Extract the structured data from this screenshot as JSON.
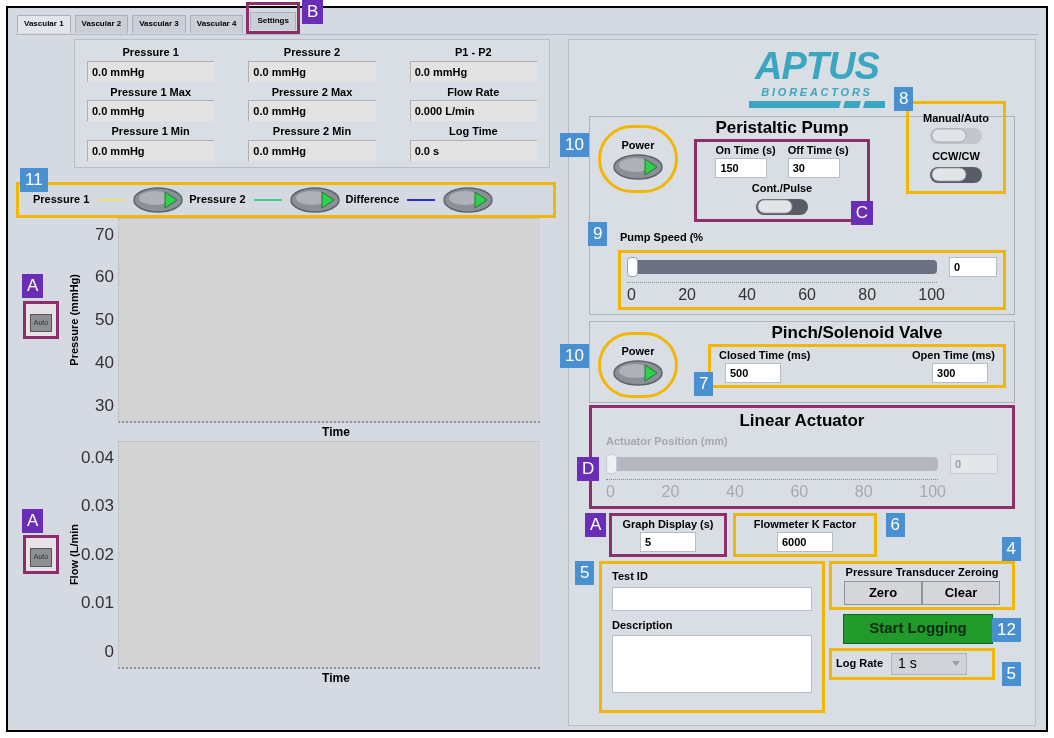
{
  "tabs": [
    {
      "label": "Vascular 1",
      "selected": true
    },
    {
      "label": "Vascular 2",
      "selected": false
    },
    {
      "label": "Vascular 3",
      "selected": false
    },
    {
      "label": "Vascular 4",
      "selected": false
    },
    {
      "label": "Settings",
      "selected": false,
      "callout": {
        "label": "B",
        "kind": "letter"
      }
    }
  ],
  "readouts": [
    {
      "label": "Pressure 1",
      "value": "0.0 mmHg"
    },
    {
      "label": "Pressure 2",
      "value": "0.0 mmHg"
    },
    {
      "label": "P1 - P2",
      "value": "0.0 mmHg"
    },
    {
      "label": "Pressure 1 Max",
      "value": "0.0 mmHg"
    },
    {
      "label": "Pressure 2 Max",
      "value": "0.0 mmHg"
    },
    {
      "label": "Flow Rate",
      "value": "0.000 L/min"
    },
    {
      "label": "Pressure 1 Min",
      "value": "0.0 mmHg"
    },
    {
      "label": "Pressure 2 Min",
      "value": "0.0 mmHg"
    },
    {
      "label": "Log Time",
      "value": "0.0 s"
    }
  ],
  "plot_toggles": {
    "callout": {
      "label": "11",
      "kind": "number"
    },
    "items": [
      {
        "label": "Pressure 1",
        "color": "#e6e27a",
        "on": true
      },
      {
        "label": "Pressure 2",
        "color": "#3fcf8a",
        "on": true
      },
      {
        "label": "Difference",
        "color": "#3030c8",
        "on": true
      }
    ]
  },
  "pressure_chart": {
    "ylabel": "Pressure (mmHg)",
    "yticks": [
      "70",
      "60",
      "50",
      "40",
      "30"
    ],
    "xlabel": "Time",
    "autoscale": {
      "label": "Auto",
      "callout": {
        "label": "A",
        "kind": "letter"
      }
    }
  },
  "flow_chart": {
    "ylabel": "Flow (L/min",
    "yticks": [
      "0.04",
      "0.03",
      "0.02",
      "0.01",
      "0"
    ],
    "xlabel": "Time",
    "autoscale": {
      "label": "Auto",
      "callout": {
        "label": "A",
        "kind": "letter"
      }
    }
  },
  "logo": {
    "name": "APTUS",
    "tagline": "BIOREACTORS"
  },
  "peristaltic_pump": {
    "title": "Peristaltic Pump",
    "power": {
      "label": "Power",
      "on": true,
      "callout": {
        "label": "10",
        "kind": "number"
      }
    },
    "timing": {
      "callout": {
        "label": "C",
        "kind": "letter"
      },
      "on_time": {
        "label": "On Time (s)",
        "value": "150"
      },
      "off_time": {
        "label": "Off Time (s)",
        "value": "30"
      },
      "mode": {
        "label": "Cont./Pulse",
        "on": true
      }
    },
    "switches": {
      "callout": {
        "label": "8",
        "kind": "number"
      },
      "items": [
        {
          "label": "Manual/Auto",
          "on": false
        },
        {
          "label": "CCW/CW",
          "on": true
        }
      ]
    },
    "speed": {
      "label": "Pump Speed (%",
      "callout": {
        "label": "9",
        "kind": "number"
      },
      "level": 0,
      "value": "0",
      "ticks": [
        "0",
        "20",
        "40",
        "60",
        "80",
        "100"
      ],
      "disabled": false
    }
  },
  "valve": {
    "title": "Pinch/Solenoid Valve",
    "power": {
      "label": "Power",
      "on": true,
      "callout": {
        "label": "10",
        "kind": "number"
      }
    },
    "timing": {
      "callout": {
        "label": "7",
        "kind": "number"
      },
      "closed_time": {
        "label": "Closed Time (ms)",
        "value": "500"
      },
      "open_time": {
        "label": "Open Time (ms)",
        "value": "300"
      }
    }
  },
  "actuator": {
    "title": "Linear Actuator",
    "callout": {
      "label": "D",
      "kind": "letter"
    },
    "slider": {
      "label": "Actuator Position (mm)",
      "level": 0,
      "value": "0",
      "ticks": [
        "0",
        "20",
        "40",
        "60",
        "80",
        "100"
      ],
      "disabled": true
    }
  },
  "graph_display": {
    "label": "Graph Display (s)",
    "value": "5",
    "callout": {
      "label": "A",
      "kind": "letter"
    }
  },
  "k_factor": {
    "label": "Flowmeter K Factor",
    "value": "6000",
    "callout": {
      "label": "6",
      "kind": "number"
    }
  },
  "test_info": {
    "callout": {
      "label": "5",
      "kind": "number"
    },
    "test_id": {
      "label": "Test ID"
    },
    "description": {
      "label": "Description"
    }
  },
  "zeroing": {
    "title": "Pressure Transducer Zeroing",
    "buttons": [
      "Zero",
      "Clear"
    ],
    "callout": {
      "label": "4",
      "kind": "number"
    }
  },
  "start_logging": {
    "label": "Start Logging",
    "callout": {
      "label": "12",
      "kind": "number"
    }
  },
  "log_rate": {
    "label": "Log Rate",
    "value": "1 s",
    "callout": {
      "label": "5",
      "kind": "number"
    }
  }
}
